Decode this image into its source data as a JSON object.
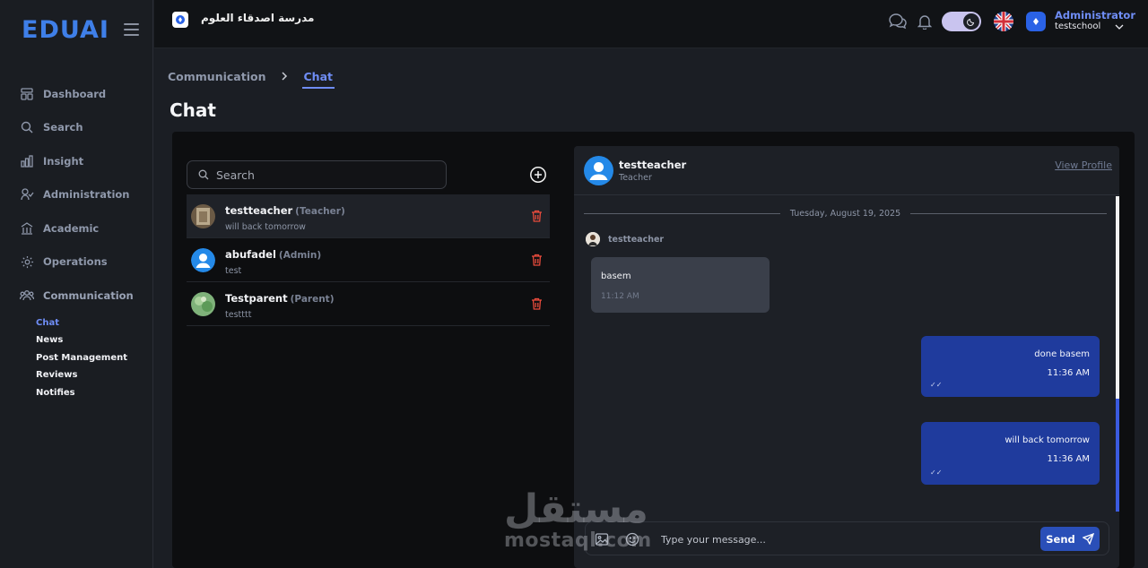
{
  "app": {
    "logo_text": "EDUAI",
    "school_name": "مدرسة اصدقاء العلوم"
  },
  "sidebar": {
    "items": [
      {
        "label": "Dashboard",
        "icon": "dashboard-icon"
      },
      {
        "label": "Search",
        "icon": "search-icon"
      },
      {
        "label": "Insight",
        "icon": "chart-icon"
      },
      {
        "label": "Administration",
        "icon": "user-check-icon"
      },
      {
        "label": "Academic",
        "icon": "building-icon"
      },
      {
        "label": "Operations",
        "icon": "gear-icon"
      },
      {
        "label": "Communication",
        "icon": "users-icon"
      }
    ],
    "sub_items": [
      "Chat",
      "News",
      "Post Management",
      "Reviews",
      "Notifies"
    ]
  },
  "header": {
    "user_name": "Administrator",
    "user_school": "testschool"
  },
  "breadcrumb": {
    "parent": "Communication",
    "current": "Chat"
  },
  "page_title": "Chat",
  "contacts": {
    "search_placeholder": "Search",
    "list": [
      {
        "name": "testteacher",
        "role": "(Teacher)",
        "last": "will back tomorrow"
      },
      {
        "name": "abufadel",
        "role": "(Admin)",
        "last": "test"
      },
      {
        "name": "Testparent",
        "role": "(Parent)",
        "last": "testttt"
      }
    ]
  },
  "conversation": {
    "name": "testteacher",
    "role": "Teacher",
    "view_profile": "View Profile",
    "date": "Tuesday, August 19, 2025",
    "sender": "testteacher",
    "messages": [
      {
        "text": "basem",
        "time": "11:12 AM",
        "direction": "in"
      },
      {
        "text": "done basem",
        "time": "11:36 AM",
        "direction": "out"
      },
      {
        "text": "will back tomorrow",
        "time": "11:36 AM",
        "direction": "out"
      }
    ],
    "input_placeholder": "Type your message...",
    "send_label": "Send"
  },
  "watermark": {
    "arabic": "مستقل",
    "latin": "mostaql.com"
  },
  "colors": {
    "accent": "#6f8df5",
    "bubble_out": "#1f3b9d",
    "bubble_in": "#3a3f4a",
    "danger": "#e84b3c"
  }
}
